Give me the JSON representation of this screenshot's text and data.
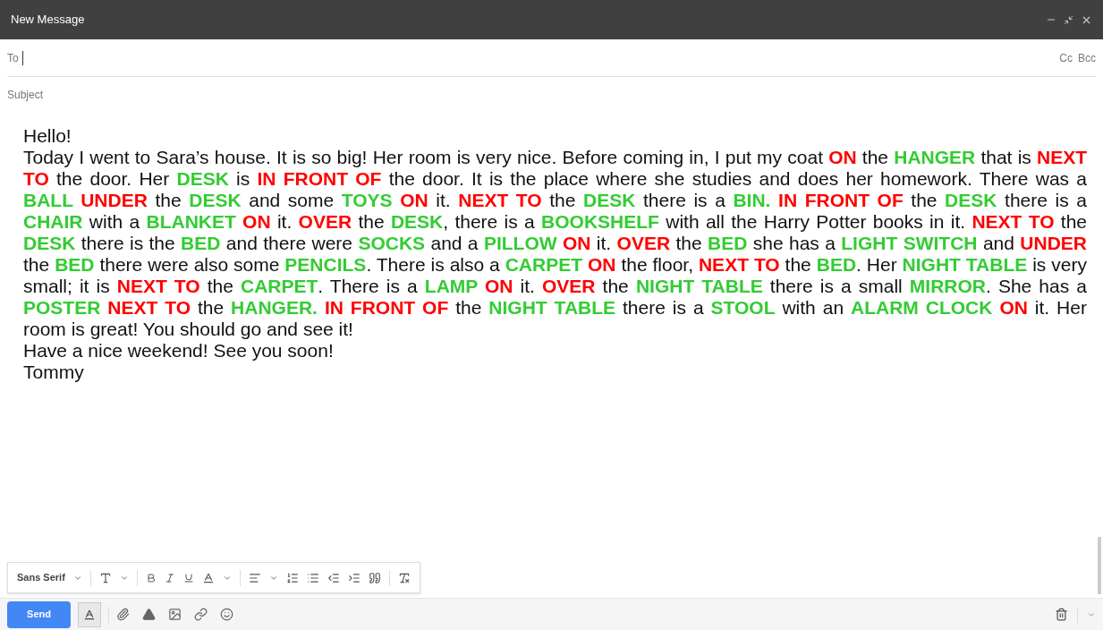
{
  "window": {
    "title": "New Message"
  },
  "to": {
    "label": "To",
    "cc": "Cc",
    "bcc": "Bcc"
  },
  "subject": {
    "placeholder": "Subject"
  },
  "body": {
    "greeting": "Hello!",
    "segments": [
      {
        "text": "Today I went to Sara’s house. It is so big! Her room is very nice. Before coming in, I put my coat "
      },
      {
        "text": "ON",
        "color": "#ff0000"
      },
      {
        "text": " the "
      },
      {
        "text": "HANGER",
        "color": "#33cc33"
      },
      {
        "text": " that is "
      },
      {
        "text": "NEXT TO",
        "color": "#ff0000"
      },
      {
        "text": " the door. Her "
      },
      {
        "text": "DESK",
        "color": "#33cc33"
      },
      {
        "text": " is "
      },
      {
        "text": "IN FRONT OF",
        "color": "#ff0000"
      },
      {
        "text": " the door. It is the place where she studies and does her homework. There was a "
      },
      {
        "text": "BALL ",
        "color": "#33cc33"
      },
      {
        "text": "UNDER",
        "color": "#ff0000"
      },
      {
        "text": " the "
      },
      {
        "text": "DESK",
        "color": "#33cc33"
      },
      {
        "text": " and some "
      },
      {
        "text": "TOYS ",
        "color": "#33cc33"
      },
      {
        "text": "ON",
        "color": "#ff0000"
      },
      {
        "text": " it. "
      },
      {
        "text": "NEXT TO",
        "color": "#ff0000"
      },
      {
        "text": " the "
      },
      {
        "text": "DESK",
        "color": "#33cc33"
      },
      {
        "text": " there is a "
      },
      {
        "text": "BIN. ",
        "color": "#33cc33"
      },
      {
        "text": "IN FRONT OF",
        "color": "#ff0000"
      },
      {
        "text": " the "
      },
      {
        "text": "DESK",
        "color": "#33cc33"
      },
      {
        "text": " there is a "
      },
      {
        "text": "CHAIR",
        "color": "#33cc33"
      },
      {
        "text": " with a "
      },
      {
        "text": "BLANKET ",
        "color": "#33cc33"
      },
      {
        "text": "ON",
        "color": "#ff0000"
      },
      {
        "text": " it. "
      },
      {
        "text": "OVER",
        "color": "#ff0000"
      },
      {
        "text": " the "
      },
      {
        "text": "DESK",
        "color": "#33cc33"
      },
      {
        "text": ", there is a "
      },
      {
        "text": "BOOKSHELF",
        "color": "#33cc33"
      },
      {
        "text": " with all the Harry Potter books in it. "
      },
      {
        "text": "NEXT TO",
        "color": "#ff0000"
      },
      {
        "text": " the "
      },
      {
        "text": "DESK",
        "color": "#33cc33"
      },
      {
        "text": " there is the "
      },
      {
        "text": "BED",
        "color": "#33cc33"
      },
      {
        "text": " and there were "
      },
      {
        "text": "SOCKS",
        "color": "#33cc33"
      },
      {
        "text": " and a "
      },
      {
        "text": "PILLOW ",
        "color": "#33cc33"
      },
      {
        "text": "ON",
        "color": "#ff0000"
      },
      {
        "text": " it. "
      },
      {
        "text": "OVER",
        "color": "#ff0000"
      },
      {
        "text": " the "
      },
      {
        "text": "BED",
        "color": "#33cc33"
      },
      {
        "text": " she has a "
      },
      {
        "text": "LIGHT SWITCH",
        "color": "#33cc33"
      },
      {
        "text": " and "
      },
      {
        "text": "UNDER",
        "color": "#ff0000"
      },
      {
        "text": " the "
      },
      {
        "text": "BED",
        "color": "#33cc33"
      },
      {
        "text": " there were also some "
      },
      {
        "text": "PENCILS",
        "color": "#33cc33"
      },
      {
        "text": ". There is also a "
      },
      {
        "text": "CARPET ",
        "color": "#33cc33"
      },
      {
        "text": "ON",
        "color": "#ff0000"
      },
      {
        "text": " the floor, "
      },
      {
        "text": "NEXT TO",
        "color": "#ff0000"
      },
      {
        "text": " the "
      },
      {
        "text": "BED",
        "color": "#33cc33"
      },
      {
        "text": ". Her "
      },
      {
        "text": "NIGHT TABLE",
        "color": "#33cc33"
      },
      {
        "text": " is very small; it is "
      },
      {
        "text": "NEXT TO",
        "color": "#ff0000"
      },
      {
        "text": " the "
      },
      {
        "text": "CARPET",
        "color": "#33cc33"
      },
      {
        "text": ". There is a "
      },
      {
        "text": "LAMP ",
        "color": "#33cc33"
      },
      {
        "text": "ON",
        "color": "#ff0000"
      },
      {
        "text": " it. "
      },
      {
        "text": "OVER",
        "color": "#ff0000"
      },
      {
        "text": " the "
      },
      {
        "text": "NIGHT TABLE",
        "color": "#33cc33"
      },
      {
        "text": " there is a small "
      },
      {
        "text": "MIRROR",
        "color": "#33cc33"
      },
      {
        "text": ". She has a "
      },
      {
        "text": "POSTER ",
        "color": "#33cc33"
      },
      {
        "text": "NEXT TO",
        "color": "#ff0000"
      },
      {
        "text": " the "
      },
      {
        "text": "HANGER. ",
        "color": "#33cc33"
      },
      {
        "text": "IN FRONT OF",
        "color": "#ff0000"
      },
      {
        "text": " the "
      },
      {
        "text": "NIGHT TABLE",
        "color": "#33cc33"
      },
      {
        "text": " there is a "
      },
      {
        "text": "STOOL",
        "color": "#33cc33"
      },
      {
        "text": " with an "
      },
      {
        "text": "ALARM CLOCK ",
        "color": "#33cc33"
      },
      {
        "text": "ON",
        "color": "#ff0000"
      },
      {
        "text": " it. Her room is great! You should go and see it!"
      }
    ],
    "closing": "Have a nice weekend! See you soon!",
    "signature": "Tommy"
  },
  "format_toolbar": {
    "font": "Sans Serif"
  },
  "send_button": {
    "label": "Send"
  }
}
